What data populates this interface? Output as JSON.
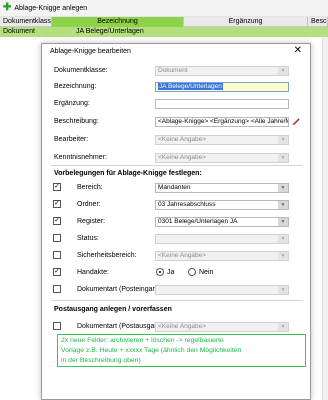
{
  "toolbar": {
    "add_label": "Ablage-Knigge anlegen"
  },
  "grid": {
    "headers": [
      "Dokumentklasse",
      "Bezeichnung",
      "Ergänzung",
      "Beschr"
    ],
    "row": [
      "Dokument",
      "JA Belege/Unterlagen",
      "",
      ""
    ]
  },
  "dialog": {
    "title": "Ablage-Knigge bearbeiten",
    "fields": {
      "dokumentklasse": {
        "label": "Dokumentklasse:",
        "value": "Dokument"
      },
      "bezeichnung": {
        "label": "Bezeichnung:",
        "value": "JA Belege/Unterlagen"
      },
      "ergaenzung": {
        "label": "Ergänzung:",
        "value": ""
      },
      "beschreibung": {
        "label": "Beschreibung:",
        "value": "<Ablage-Knigge> <Ergänzung> <Alle Jahre/Monat>"
      },
      "bearbeiter": {
        "label": "Bearbeiter:",
        "value": "<Keine Angabe>"
      },
      "kenntnisnehmer": {
        "label": "Kenntnisnehmer:",
        "value": "<Keine Angabe>"
      }
    },
    "section1_title": "Vorbelegungen für Ablage-Knigge festlegen:",
    "presets": {
      "bereich": {
        "label": "Bereich:",
        "value": "Mandanten",
        "checked": true
      },
      "ordner": {
        "label": "Ordner:",
        "value": "03 Jahresabschluss",
        "checked": true
      },
      "register": {
        "label": "Register:",
        "value": "0301 Belege/Unterlagen JA",
        "checked": true
      },
      "status": {
        "label": "Status:",
        "value": "",
        "checked": false
      },
      "sicherheitsbereich": {
        "label": "Sicherheitsbereich:",
        "value": "<Keine Angabe>",
        "checked": false
      },
      "handakte": {
        "label": "Handakte:",
        "checked": true,
        "yes_label": "Ja",
        "no_label": "Nein",
        "selected": "Ja"
      },
      "dokumentart_posteingang": {
        "label": "Dokumentart (Posteingang):",
        "value": "",
        "checked": false
      }
    },
    "section2_title": "Postausgang anlegen / vorerfassen",
    "postausgang": {
      "dokumentart_postausgang": {
        "label": "Dokumentart (Postausgang):",
        "value": "<Keine Angabe>",
        "checked": false
      }
    }
  },
  "note": {
    "line1": "2x neue Felder: archivieren + löschen -> regelbasierte",
    "line2": "Vorlage z.B. Heute + xxxxx Tage (ähnlich den Möglichkeiten",
    "line3": "in der Beschreibung oben)"
  },
  "colors": {
    "accent_green": "#8ed24a",
    "row_green": "#b3df7e",
    "note_green": "#1cb84a"
  }
}
